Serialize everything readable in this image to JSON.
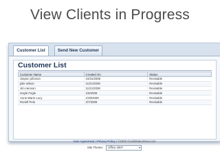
{
  "slide": {
    "title": "View Clients in Progress"
  },
  "tabs": [
    {
      "label": "Customer List"
    },
    {
      "label": "Send New Customer"
    }
  ],
  "content": {
    "heading": "Customer List",
    "columns": [
      "Customer Name",
      "Created On",
      "Status"
    ],
    "rows": [
      [
        "clayton johnson",
        "10/31/2008",
        "Revisable"
      ],
      [
        "julie wilson",
        "11/21/2008",
        "Revisable"
      ],
      [
        "Jim Henson",
        "11/21/2008",
        "Revisable"
      ],
      [
        "Gayle Fogle",
        "1/5/2009",
        "Revisable"
      ],
      [
        "Anne-Marie Lucy",
        "1/29/2009",
        "Revisable"
      ],
      [
        "Ronell Pete",
        "2/7/2009",
        "Revisable"
      ]
    ]
  },
  "footer": {
    "user_agreement": "User Agreement",
    "separator": " | ",
    "privacy_policy": "Privacy Policy",
    "copyright": " | ©2005 CreditStatusNow.com",
    "site_theme_label": "Site Theme:",
    "site_theme_value": "Office 2007"
  }
}
